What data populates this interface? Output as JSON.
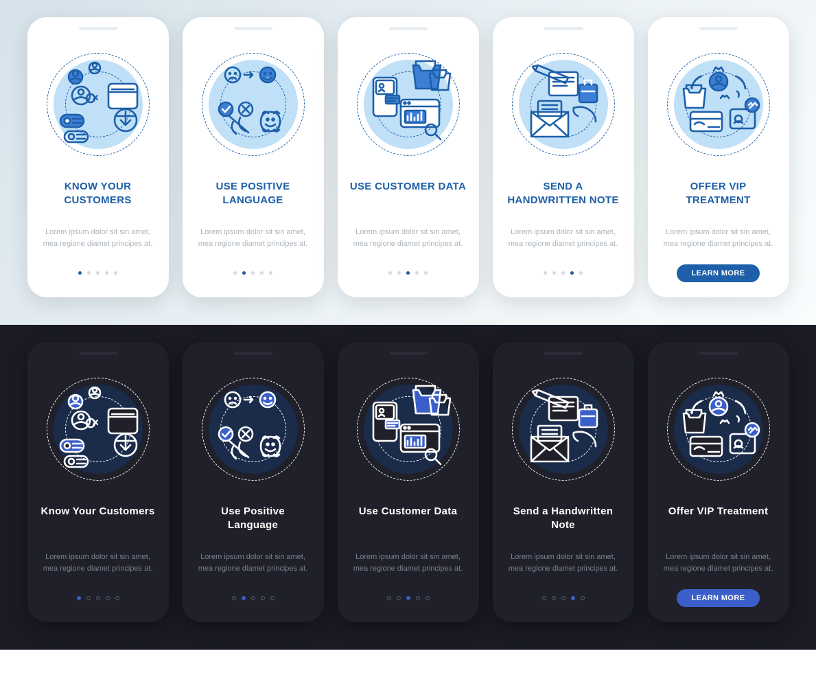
{
  "themes": {
    "light": {
      "accent": "#1d5fa9",
      "card_bg": "#ffffff",
      "title_transform": "uppercase"
    },
    "dark": {
      "accent": "#3a5fc9",
      "card_bg": "#1f2029"
    }
  },
  "lorem": "Lorem ipsum dolor sit sin amet, mea regione diamet principes at.",
  "button_label": "LEARN MORE",
  "light_screens": [
    {
      "title": "KNOW YOUR CUSTOMERS",
      "icon": "know-customers-icon",
      "active_dot": 0,
      "dot_count": 5
    },
    {
      "title": "USE POSITIVE LANGUAGE",
      "icon": "positive-language-icon",
      "active_dot": 1,
      "dot_count": 5
    },
    {
      "title": "USE CUSTOMER DATA",
      "icon": "customer-data-icon",
      "active_dot": 2,
      "dot_count": 5
    },
    {
      "title": "SEND A HANDWRITTEN NOTE",
      "icon": "handwritten-note-icon",
      "active_dot": 3,
      "dot_count": 5
    },
    {
      "title": "OFFER VIP TREATMENT",
      "icon": "vip-treatment-icon",
      "has_button": true
    }
  ],
  "dark_screens": [
    {
      "title": "Know Your Customers",
      "icon": "know-customers-icon",
      "active_dot": 0,
      "dot_count": 5
    },
    {
      "title": "Use Positive Language",
      "icon": "positive-language-icon",
      "active_dot": 1,
      "dot_count": 5
    },
    {
      "title": "Use Customer Data",
      "icon": "customer-data-icon",
      "active_dot": 2,
      "dot_count": 5
    },
    {
      "title": "Send a Handwritten Note",
      "icon": "handwritten-note-icon",
      "active_dot": 3,
      "dot_count": 5
    },
    {
      "title": "Offer VIP Treatment",
      "icon": "vip-treatment-icon",
      "has_button": true
    }
  ]
}
